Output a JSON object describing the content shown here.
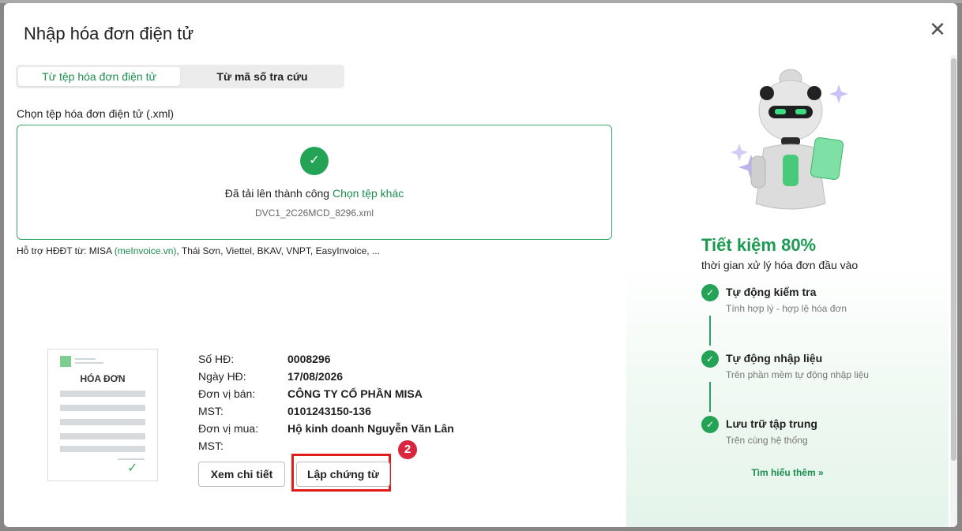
{
  "dialog": {
    "title": "Nhập hóa đơn điện tử",
    "close_icon": "close-icon"
  },
  "tabs": [
    {
      "label": "Từ tệp hóa đơn điện tử",
      "active": true
    },
    {
      "label": "Từ mã số tra cứu",
      "active": false
    }
  ],
  "upload": {
    "label": "Chọn tệp hóa đơn điện tử (.xml)",
    "status_text": "Đã tải lên thành công",
    "change_link": "Chọn tệp khác",
    "filename": "DVC1_2C26MCD_8296.xml",
    "support_prefix": "Hỗ trợ HĐĐT từ: MISA",
    "support_link": "(meInvoice.vn)",
    "support_suffix": ", Thái Sơn, Viettel, BKAV, VNPT, EasyInvoice, ..."
  },
  "invoice_thumbnail": {
    "heading": "HÓA ĐƠN"
  },
  "invoice": [
    {
      "label": "Số HĐ:",
      "value": "0008296"
    },
    {
      "label": "Ngày HĐ:",
      "value": "17/08/2026"
    },
    {
      "label": "Đơn vị bán:",
      "value": "CÔNG TY CỔ PHẦN MISA"
    },
    {
      "label": "MST:",
      "value": "0101243150-136"
    },
    {
      "label": "Đơn vị mua:",
      "value": "Hộ kinh doanh Nguyễn Văn Lân"
    },
    {
      "label": "MST:",
      "value": ""
    }
  ],
  "actions": {
    "detail_label": "Xem chi tiết",
    "create_label": "Lập chứng từ",
    "step_badge": "2"
  },
  "promo": {
    "title": "Tiết kiệm 80%",
    "subtitle": "thời gian xử lý hóa đơn đầu vào",
    "features": [
      {
        "title": "Tự động kiểm tra",
        "desc": "Tính hợp lý - hợp lệ hóa đơn"
      },
      {
        "title": "Tự động nhập liệu",
        "desc": "Trên phần mềm tự động nhập liệu"
      },
      {
        "title": "Lưu trữ tập trung",
        "desc": "Trên cùng hệ thống"
      }
    ],
    "learn_more": "Tìm hiểu thêm",
    "learn_more_icon": "double-chevron-right-icon"
  },
  "colors": {
    "accent": "#1b9a52",
    "highlight": "#e21b1b"
  }
}
